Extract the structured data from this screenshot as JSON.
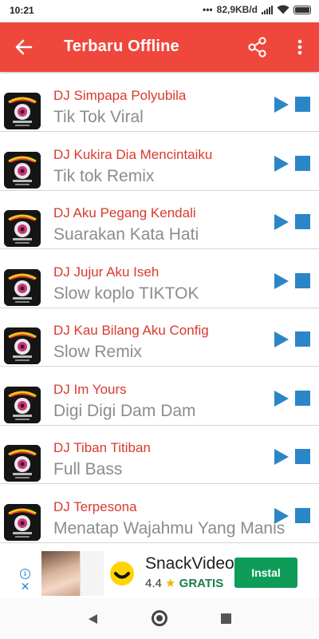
{
  "status_bar": {
    "time": "10:21",
    "dots": "•••",
    "network_speed": "82,9KB/d"
  },
  "app_bar": {
    "title": "Terbaru Offline",
    "back_icon": "arrow-left-icon",
    "share_icon": "share-icon",
    "more_icon": "more-vert-icon",
    "color": "#f0473d"
  },
  "songs": [
    {
      "title": "DJ Simpapa Polyubila",
      "subtitle": "Tik Tok Viral"
    },
    {
      "title": "DJ Kukira Dia Mencintaiku",
      "subtitle": "Tik tok Remix"
    },
    {
      "title": "DJ Aku Pegang Kendali",
      "subtitle": "Suarakan Kata Hati"
    },
    {
      "title": "DJ Jujur Aku Iseh",
      "subtitle": "Slow koplo TIKTOK"
    },
    {
      "title": "DJ Kau Bilang Aku Config",
      "subtitle": "Slow Remix"
    },
    {
      "title": "DJ Im Yours",
      "subtitle": "Digi Digi Dam Dam"
    },
    {
      "title": "DJ Tiban Titiban",
      "subtitle": "Full Bass"
    },
    {
      "title": "DJ Terpesona",
      "subtitle": "Menatap Wajahmu Yang Manis"
    }
  ],
  "colors": {
    "title_red": "#d93a2c",
    "subtitle_gray": "#8c8c8c",
    "control_blue": "#2b86c8"
  },
  "ad": {
    "app_name": "SnackVideo",
    "rating": "4.4",
    "star": "★",
    "price": "GRATIS",
    "install_label": "Instal",
    "install_color": "#0e9c58",
    "info_icon": "info-icon",
    "close_icon": "close-icon"
  }
}
